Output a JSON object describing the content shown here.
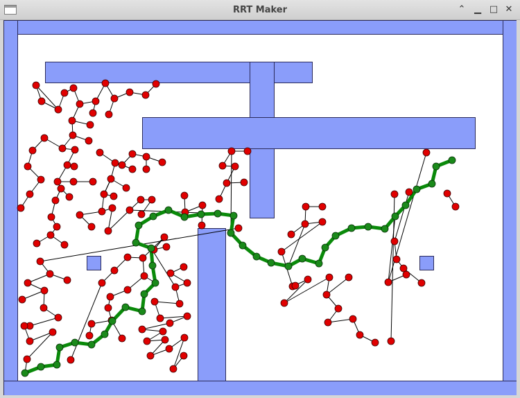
{
  "window": {
    "title": "RRT Maker",
    "icons": {
      "app": "window-icon",
      "collapse": "chevron-up-icon",
      "minimize": "minimize-icon",
      "maximize": "maximize-icon",
      "close": "close-icon"
    }
  },
  "colors": {
    "obstacle_fill": "#8a9dfa",
    "obstacle_stroke": "#2a2a5a",
    "tree_node": "#e00000",
    "tree_edge": "#000000",
    "path_node": "#1a8a1a",
    "path_edge": "#0a8a0a",
    "titlebar": "#d8d8d8",
    "background": "#ffffff"
  }
}
